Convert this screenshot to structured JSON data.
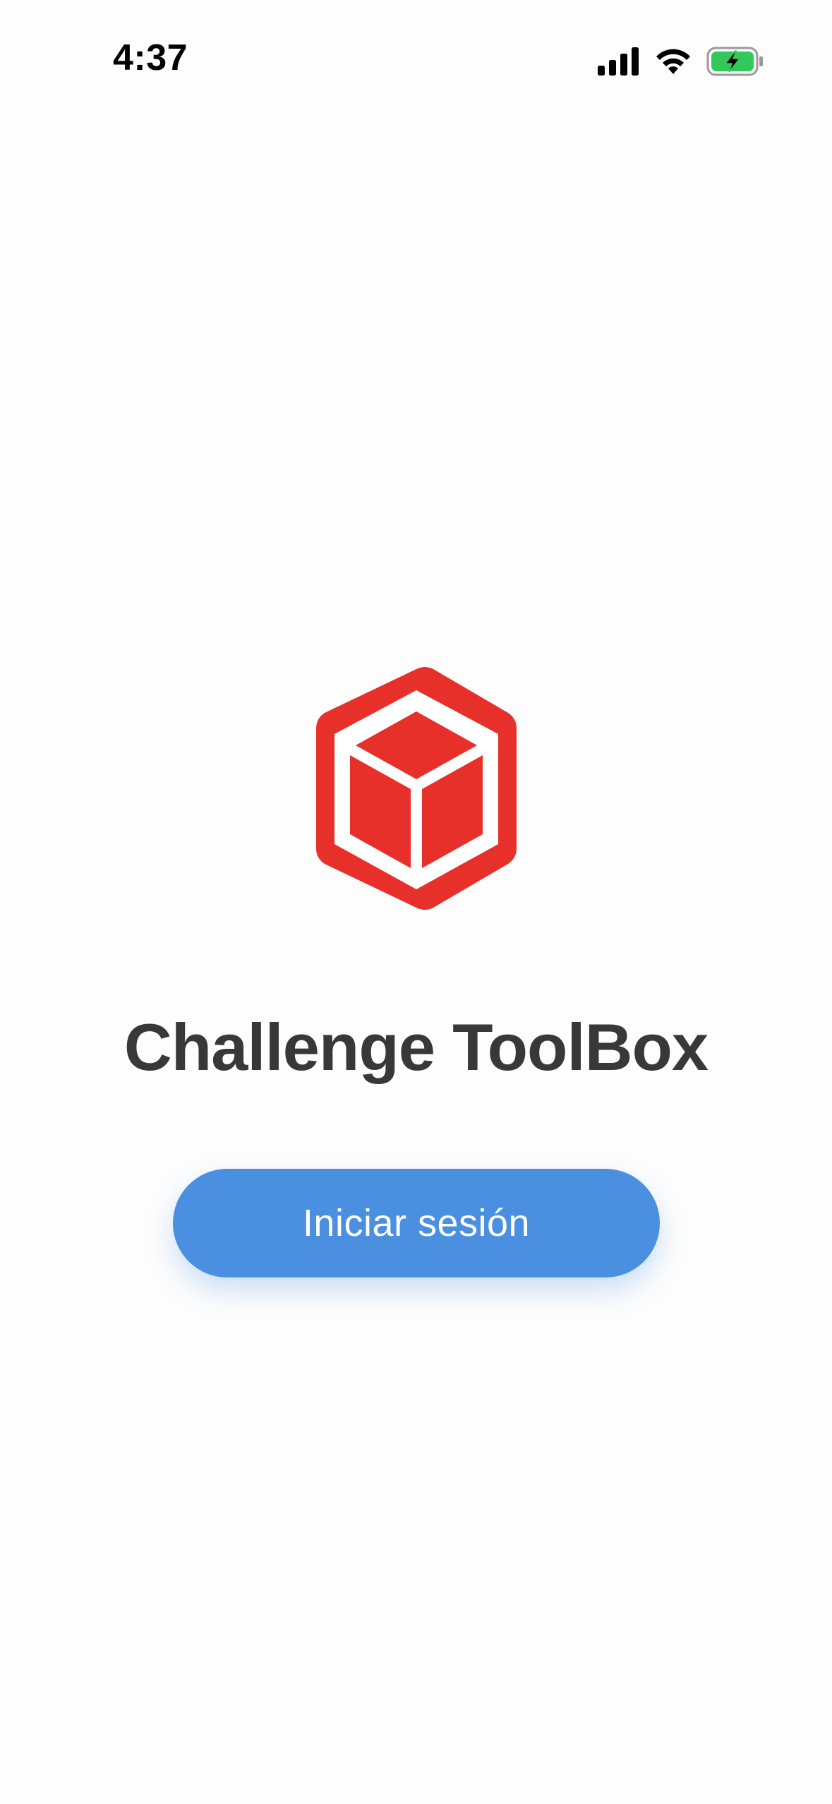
{
  "status_bar": {
    "time": "4:37",
    "icons": [
      "cellular-signal-icon",
      "wifi-icon",
      "battery-charging-icon"
    ],
    "battery_color": "#34c759"
  },
  "main": {
    "logo": "box-icon",
    "logo_color": "#e8302b",
    "title": "Challenge ToolBox",
    "login_button_label": "Iniciar sesión",
    "accent_color": "#4a8fe0"
  }
}
